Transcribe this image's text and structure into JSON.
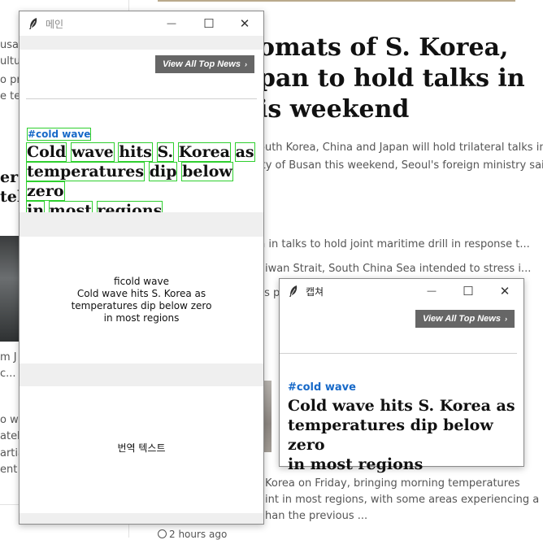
{
  "background": {
    "headline_lines": [
      "omats of S. Korea,",
      "pan to hold talks in",
      "is weekend"
    ],
    "summary_lines": [
      "outh Korea, China and Japan will hold trilateral talks in",
      "ity of Busan this weekend, Seoul's foreign ministry said"
    ],
    "story2_lines": [
      "n in talks to hold joint maritime drill in response t...",
      "aiwan Strait, South China Sea intended to stress i...",
      "cs p"
    ],
    "story3_lines": [
      "Korea on Friday, bringing morning temperatures",
      "int in most regions, with some areas experiencing a",
      "han the previous ..."
    ],
    "timestamp": "2 hours ago",
    "left_fragments": [
      "usa",
      "ultu",
      "o pri",
      "e te",
      "er I",
      "tell",
      "m J",
      "c...",
      "o w",
      "atell",
      "artia",
      "ent"
    ]
  },
  "main_window": {
    "title": "메인",
    "view_all_label": "View All Top News",
    "tag_label": "#cold wave",
    "headline_words": [
      "Cold",
      "wave",
      "hits",
      "S.",
      "Korea",
      "as",
      "temperatures",
      "dip",
      "below",
      "zero",
      "in",
      "most",
      "regions"
    ],
    "plain_text_lines": [
      "ficold wave",
      "Cold wave hits S. Korea as",
      "temperatures dip below zero",
      "in most regions"
    ],
    "translation_label": "번역 텍스트"
  },
  "capture_window": {
    "title": "캡쳐",
    "view_all_label": "View All Top News",
    "tag_label": "#cold wave",
    "headline_lines": [
      "Cold wave hits S. Korea as",
      "temperatures dip below zero",
      "in most regions"
    ]
  },
  "controls": {
    "minimize": "—",
    "maximize": "☐",
    "close": "✕"
  }
}
